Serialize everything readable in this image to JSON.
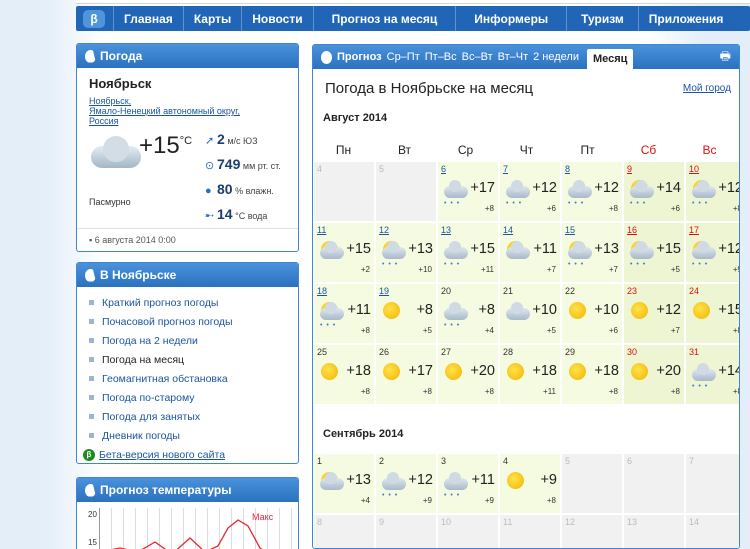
{
  "nav": {
    "items": [
      "Главная",
      "Карты",
      "Новости",
      "Прогноз на месяц",
      "Информеры",
      "Туризм",
      "Приложения"
    ]
  },
  "current": {
    "header": "Погода",
    "city": "Ноябрьск",
    "region": [
      "Ноябрьск,",
      "Ямало-Ненецкий автономный округ,",
      "Россия"
    ],
    "temp": "+15",
    "unit": "°C",
    "wind": "2",
    "wind_unit": "м/с",
    "wind_dir": "ЮЗ",
    "pressure": "749",
    "pressure_unit": "мм рт. ст.",
    "humidity": "80",
    "humidity_unit": "% влажн.",
    "water": "14",
    "water_unit": "°C вода",
    "sky": "Пасмурно",
    "date": "6 августа 2014 0:00"
  },
  "city_links": {
    "header": "В Ноябрьске",
    "items": [
      "Краткий прогноз погоды",
      "Почасовой прогноз погоды",
      "Погода на 2 недели",
      "Погода на месяц",
      "Геомагнитная обстановка",
      "Погода по-старому",
      "Погода для занятых",
      "Дневник погоды"
    ],
    "beta": "Бета-версия нового сайта"
  },
  "temp_chart": {
    "header": "Прогноз температуры",
    "label": "Макс",
    "yticks": [
      "20",
      "15"
    ]
  },
  "forecast": {
    "tab_label": "Прогноз",
    "tabs": [
      "Ср–Пт",
      "Пт–Вс",
      "Вс–Вт",
      "Вт–Чт",
      "2 недели"
    ],
    "active": "Месяц",
    "print_icon": "printer-icon",
    "title": "Погода в Ноябрьске на месяц",
    "other_city": "Мой город",
    "dow": [
      "Пн",
      "Вт",
      "Ср",
      "Чт",
      "Пт",
      "Сб",
      "Вс"
    ],
    "month1": "Август 2014",
    "aug": [
      {
        "d": "4",
        "t": "grey"
      },
      {
        "d": "5",
        "t": "grey"
      },
      {
        "d": "6",
        "hi": "+17",
        "lo": "+8",
        "ic": "cloud",
        "pr": "• • •"
      },
      {
        "d": "7",
        "hi": "+12",
        "lo": "+6",
        "ic": "cloud",
        "pr": "• • •"
      },
      {
        "d": "8",
        "hi": "+12",
        "lo": "+8",
        "ic": "cloud",
        "pr": "• • •"
      },
      {
        "d": "9",
        "hi": "+14",
        "lo": "+6",
        "ic": "sun",
        "pr": "• • •",
        "red": true
      },
      {
        "d": "10",
        "hi": "+12",
        "lo": "+8",
        "ic": "sun",
        "pr": "• • •",
        "red": true
      },
      {
        "d": "11",
        "hi": "+15",
        "lo": "+2",
        "ic": "sun"
      },
      {
        "d": "12",
        "hi": "+13",
        "lo": "+10",
        "ic": "sun",
        "pr": "• • •"
      },
      {
        "d": "13",
        "hi": "+15",
        "lo": "+11",
        "ic": "cloud",
        "pr": "• • •"
      },
      {
        "d": "14",
        "hi": "+11",
        "lo": "+7",
        "ic": "sun"
      },
      {
        "d": "15",
        "hi": "+13",
        "lo": "+7",
        "ic": "sun",
        "pr": "• • •"
      },
      {
        "d": "16",
        "hi": "+15",
        "lo": "+5",
        "ic": "sun",
        "pr": "• • •",
        "red": true
      },
      {
        "d": "17",
        "hi": "+12",
        "lo": "+9",
        "ic": "sun",
        "pr": "• • •",
        "red": true
      },
      {
        "d": "18",
        "hi": "+11",
        "lo": "+8",
        "ic": "sun",
        "pr": "• • •"
      },
      {
        "d": "19",
        "hi": "+8",
        "lo": "+5",
        "ic": "sunonly"
      },
      {
        "d": "20",
        "hi": "+8",
        "lo": "+4",
        "ic": "cloud",
        "pr": "• • •",
        "plain": true
      },
      {
        "d": "21",
        "hi": "+10",
        "lo": "+5",
        "ic": "cloud",
        "plain": true
      },
      {
        "d": "22",
        "hi": "+10",
        "lo": "+6",
        "ic": "sunonly",
        "plain": true
      },
      {
        "d": "23",
        "hi": "+12",
        "lo": "+7",
        "ic": "sunonly",
        "plain": true,
        "red": true
      },
      {
        "d": "24",
        "hi": "+15",
        "lo": "+8",
        "ic": "sunonly",
        "plain": true,
        "red": true
      },
      {
        "d": "25",
        "hi": "+18",
        "lo": "+8",
        "ic": "sunonly",
        "plain": true
      },
      {
        "d": "26",
        "hi": "+17",
        "lo": "+8",
        "ic": "sunonly",
        "plain": true
      },
      {
        "d": "27",
        "hi": "+20",
        "lo": "+8",
        "ic": "sunonly",
        "plain": true
      },
      {
        "d": "28",
        "hi": "+18",
        "lo": "+11",
        "ic": "sunonly",
        "plain": true
      },
      {
        "d": "29",
        "hi": "+18",
        "lo": "+8",
        "ic": "sunonly",
        "plain": true
      },
      {
        "d": "30",
        "hi": "+20",
        "lo": "+8",
        "ic": "sunonly",
        "plain": true,
        "red": true
      },
      {
        "d": "31",
        "hi": "+14",
        "lo": "+8",
        "ic": "cloud",
        "pr": "• • •",
        "plain": true,
        "red": true
      }
    ],
    "month2": "Сентябрь 2014",
    "sep": [
      {
        "d": "1",
        "hi": "+13",
        "lo": "+4",
        "ic": "sun",
        "plain": true
      },
      {
        "d": "2",
        "hi": "+12",
        "lo": "+9",
        "ic": "cloud",
        "pr": "• • •",
        "plain": true
      },
      {
        "d": "3",
        "hi": "+11",
        "lo": "+9",
        "ic": "cloud",
        "pr": "• • •",
        "plain": true
      },
      {
        "d": "4",
        "hi": "+9",
        "lo": "+8",
        "ic": "sunonly",
        "plain": true
      },
      {
        "d": "5",
        "t": "grey"
      },
      {
        "d": "6",
        "t": "grey"
      },
      {
        "d": "7",
        "t": "grey"
      },
      {
        "d": "8",
        "t": "grey"
      },
      {
        "d": "9",
        "t": "grey"
      },
      {
        "d": "10",
        "t": "grey"
      },
      {
        "d": "11",
        "t": "grey"
      },
      {
        "d": "12",
        "t": "grey"
      },
      {
        "d": "13",
        "t": "grey"
      },
      {
        "d": "14",
        "t": "grey"
      }
    ]
  }
}
